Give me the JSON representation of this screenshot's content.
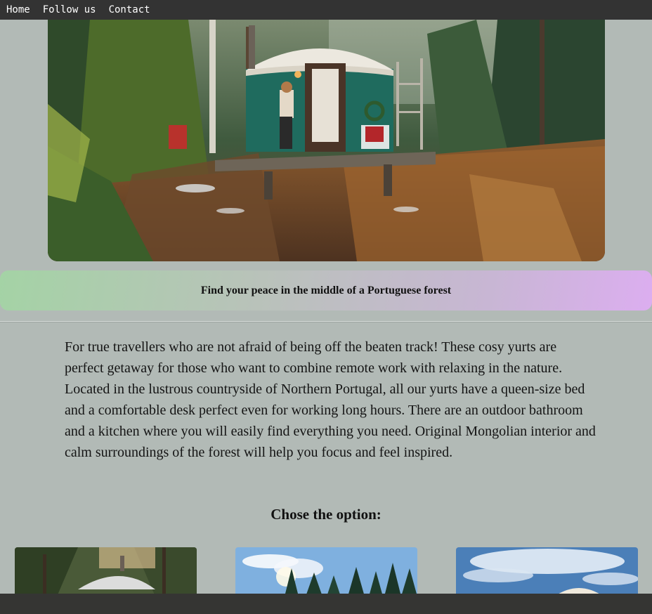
{
  "nav": {
    "items": [
      {
        "label": "Home"
      },
      {
        "label": "Follow us"
      },
      {
        "label": "Contact"
      }
    ]
  },
  "hero": {
    "image": "yurt-in-forest-photo"
  },
  "banner": {
    "text": "Find your peace in the middle of a Portuguese forest"
  },
  "intro": {
    "text": "For true travellers who are not afraid of being off the beaten track! These cosy yurts are perfect getaway for those who want to combine remote work with relaxing in the nature. Located in the lustrous countryside of Northern Portugal, all our yurts have a queen-size bed and a comfortable desk perfect even for working long hours. There are an outdoor bathroom and a kitchen where you will easily find everything you need. Original Mongolian interior and calm surroundings of the forest will help you focus and feel inspired."
  },
  "options": {
    "title": "Chose the option:",
    "cards": [
      {
        "image": "yurt-among-trees-photo"
      },
      {
        "image": "pine-forest-sunny-photo"
      },
      {
        "image": "yurt-under-sky-photo"
      }
    ]
  },
  "colors": {
    "nav_bg": "#333333",
    "page_bg": "#b2bab6",
    "banner_start": "#a4d3a5",
    "banner_end": "#dcaef0",
    "footer_bg": "#353533"
  }
}
